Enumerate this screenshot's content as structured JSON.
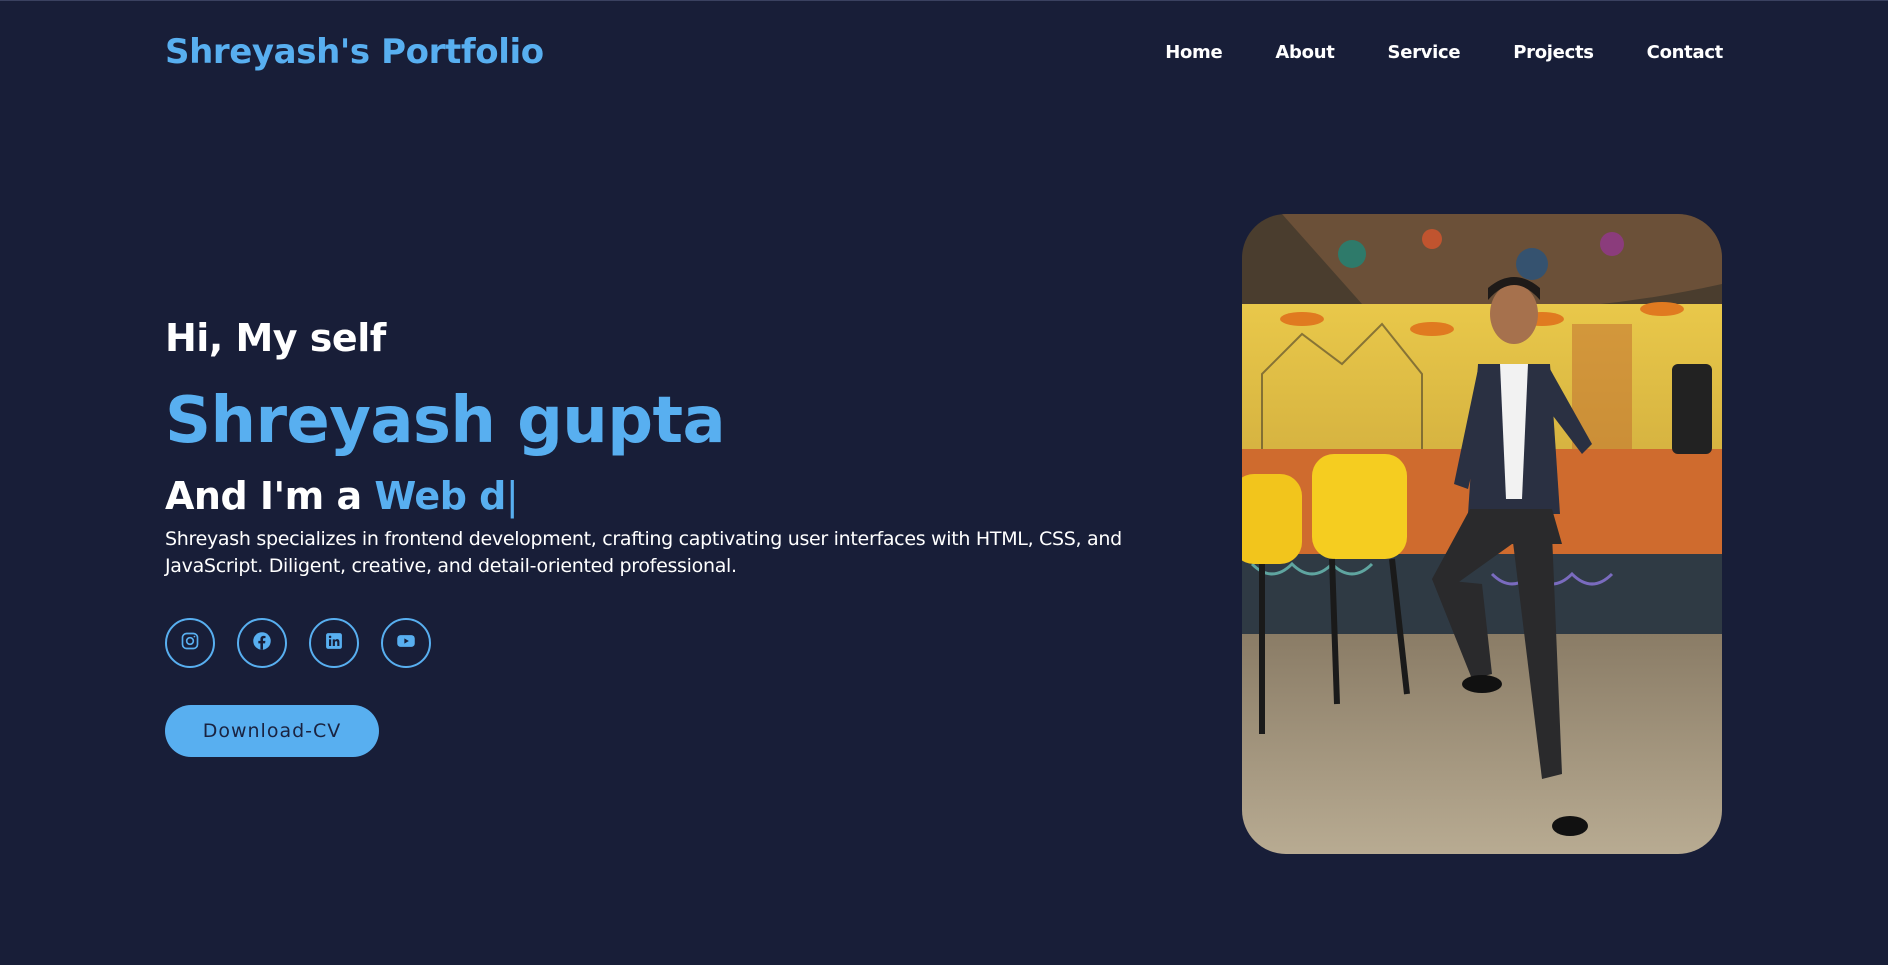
{
  "header": {
    "logo": "Shreyash's Portfolio",
    "nav": [
      {
        "label": "Home"
      },
      {
        "label": "About"
      },
      {
        "label": "Service"
      },
      {
        "label": "Projects"
      },
      {
        "label": "Contact"
      }
    ]
  },
  "hero": {
    "greeting": "Hi, My self",
    "name": "Shreyash gupta",
    "role_prefix": "And I'm a ",
    "role_typed": "Web d",
    "cursor": "|",
    "bio": "Shreyash specializes in frontend development, crafting captivating user interfaces with HTML, CSS, and JavaScript. Diligent, creative, and detail-oriented professional.",
    "socials": [
      {
        "icon": "instagram-icon"
      },
      {
        "icon": "facebook-icon"
      },
      {
        "icon": "linkedin-icon"
      },
      {
        "icon": "youtube-icon"
      }
    ],
    "cta_label": "Download-CV"
  },
  "colors": {
    "background": "#181e38",
    "accent": "#58aff0",
    "text": "#ffffff"
  }
}
